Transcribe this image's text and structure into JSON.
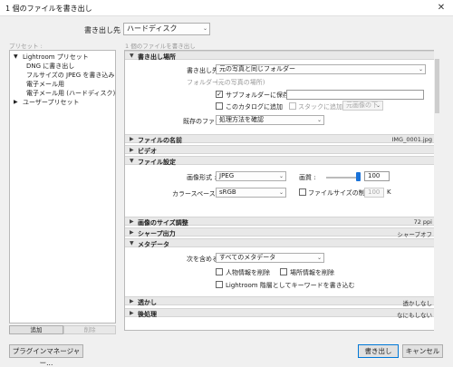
{
  "window": {
    "title": "1 個のファイルを書き出し",
    "close_glyph": "✕"
  },
  "export_to": {
    "label": "書き出し先 :",
    "value": "ハードディスク"
  },
  "presets": {
    "label": "プリセット :",
    "tree": [
      {
        "label": "Lightroom プリセット",
        "toggle": "▼"
      },
      {
        "label": "DNG に書き出し"
      },
      {
        "label": "フルサイズの JPEG を書き込み"
      },
      {
        "label": "電子メール用"
      },
      {
        "label": "電子メール用 (ハードディスク)"
      },
      {
        "label": "ユーザープリセット",
        "toggle": "▶"
      }
    ],
    "add_button": "追加",
    "remove_button": "削除"
  },
  "summary": "1 個のファイルを書き出し",
  "sections": {
    "location": {
      "toggle": "▼",
      "title": "書き出し場所",
      "export_to_label": "書き出し先 :",
      "export_to_value": "元の写真と同じフォルダー",
      "folder_label": "フォルダー :",
      "folder_value": "(元の写真の場所)",
      "subfolder_label": "サブフォルダーに保存 :",
      "subfolder_checked": "✓",
      "subfolder_value": "",
      "add_catalog_label": "このカタログに追加",
      "stack_label": "スタックに追加 :",
      "stack_value": "元画像の下",
      "existing_label": "既存のファイル :",
      "existing_value": "処理方法を確認"
    },
    "naming": {
      "toggle": "▶",
      "title": "ファイルの名前",
      "summary": "IMG_0001.jpg"
    },
    "video": {
      "toggle": "▶",
      "title": "ビデオ"
    },
    "settings": {
      "toggle": "▼",
      "title": "ファイル設定",
      "format_label": "画像形式 :",
      "format_value": "JPEG",
      "quality_label": "画質 :",
      "quality_value": "100",
      "quality_fraction": 1.0,
      "colorspace_label": "カラースペース :",
      "colorspace_value": "sRGB",
      "limit_label": "ファイルサイズの制限 :",
      "limit_value": "100",
      "limit_unit": "K"
    },
    "sizing": {
      "toggle": "▶",
      "title": "画像のサイズ調整",
      "summary": "72 ppi"
    },
    "sharpen": {
      "toggle": "▶",
      "title": "シャープ出力",
      "summary": "シャープオフ"
    },
    "metadata": {
      "toggle": "▼",
      "title": "メタデータ",
      "include_label": "次を含める :",
      "include_value": "すべてのメタデータ",
      "remove_person_label": "人物情報を削除",
      "remove_location_label": "場所情報を削除",
      "hierarchy_label": "Lightroom 階層としてキーワードを書き込む"
    },
    "watermark": {
      "toggle": "▶",
      "title": "透かし",
      "summary": "透かしなし"
    },
    "postprocess": {
      "toggle": "▶",
      "title": "後処理",
      "summary": "なにもしない"
    }
  },
  "footer": {
    "plugin_manager": "プラグインマネージャー...",
    "export": "書き出し",
    "cancel": "キャンセル"
  },
  "dropdown_arrow": "⌄"
}
